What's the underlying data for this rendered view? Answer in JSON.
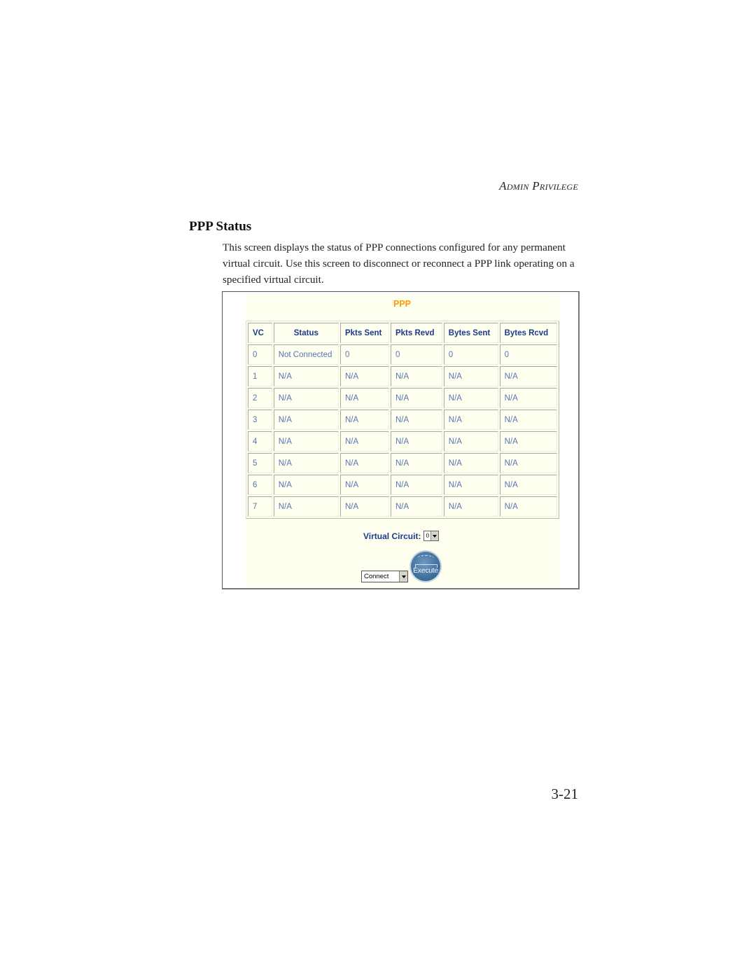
{
  "running_head": "Admin Privilege",
  "section": {
    "title": "PPP Status",
    "intro": "This screen displays the status of PPP connections configured for any permanent virtual circuit. Use this screen to disconnect or reconnect a PPP link operating on a specified virtual circuit."
  },
  "screenshot": {
    "panel_title": "PPP",
    "table": {
      "headers": [
        "VC",
        "Status",
        "Pkts Sent",
        "Pkts Revd",
        "Bytes Sent",
        "Bytes Rcvd"
      ],
      "rows": [
        [
          "0",
          "Not Connected",
          "0",
          "0",
          "0",
          "0"
        ],
        [
          "1",
          "N/A",
          "N/A",
          "N/A",
          "N/A",
          "N/A"
        ],
        [
          "2",
          "N/A",
          "N/A",
          "N/A",
          "N/A",
          "N/A"
        ],
        [
          "3",
          "N/A",
          "N/A",
          "N/A",
          "N/A",
          "N/A"
        ],
        [
          "4",
          "N/A",
          "N/A",
          "N/A",
          "N/A",
          "N/A"
        ],
        [
          "5",
          "N/A",
          "N/A",
          "N/A",
          "N/A",
          "N/A"
        ],
        [
          "6",
          "N/A",
          "N/A",
          "N/A",
          "N/A",
          "N/A"
        ],
        [
          "7",
          "N/A",
          "N/A",
          "N/A",
          "N/A",
          "N/A"
        ]
      ]
    },
    "virtual_circuit_label": "Virtual Circuit:",
    "virtual_circuit_value": "0",
    "action_value": "Connect",
    "execute_label": "Execute",
    "colors": {
      "panel_bg": "#fffff0",
      "title_orange": "#ff9900",
      "header_blue": "#1a3a8c",
      "cell_blue": "#5a74b4",
      "execute_blue": "#40709e"
    }
  },
  "page_number": "3-21"
}
